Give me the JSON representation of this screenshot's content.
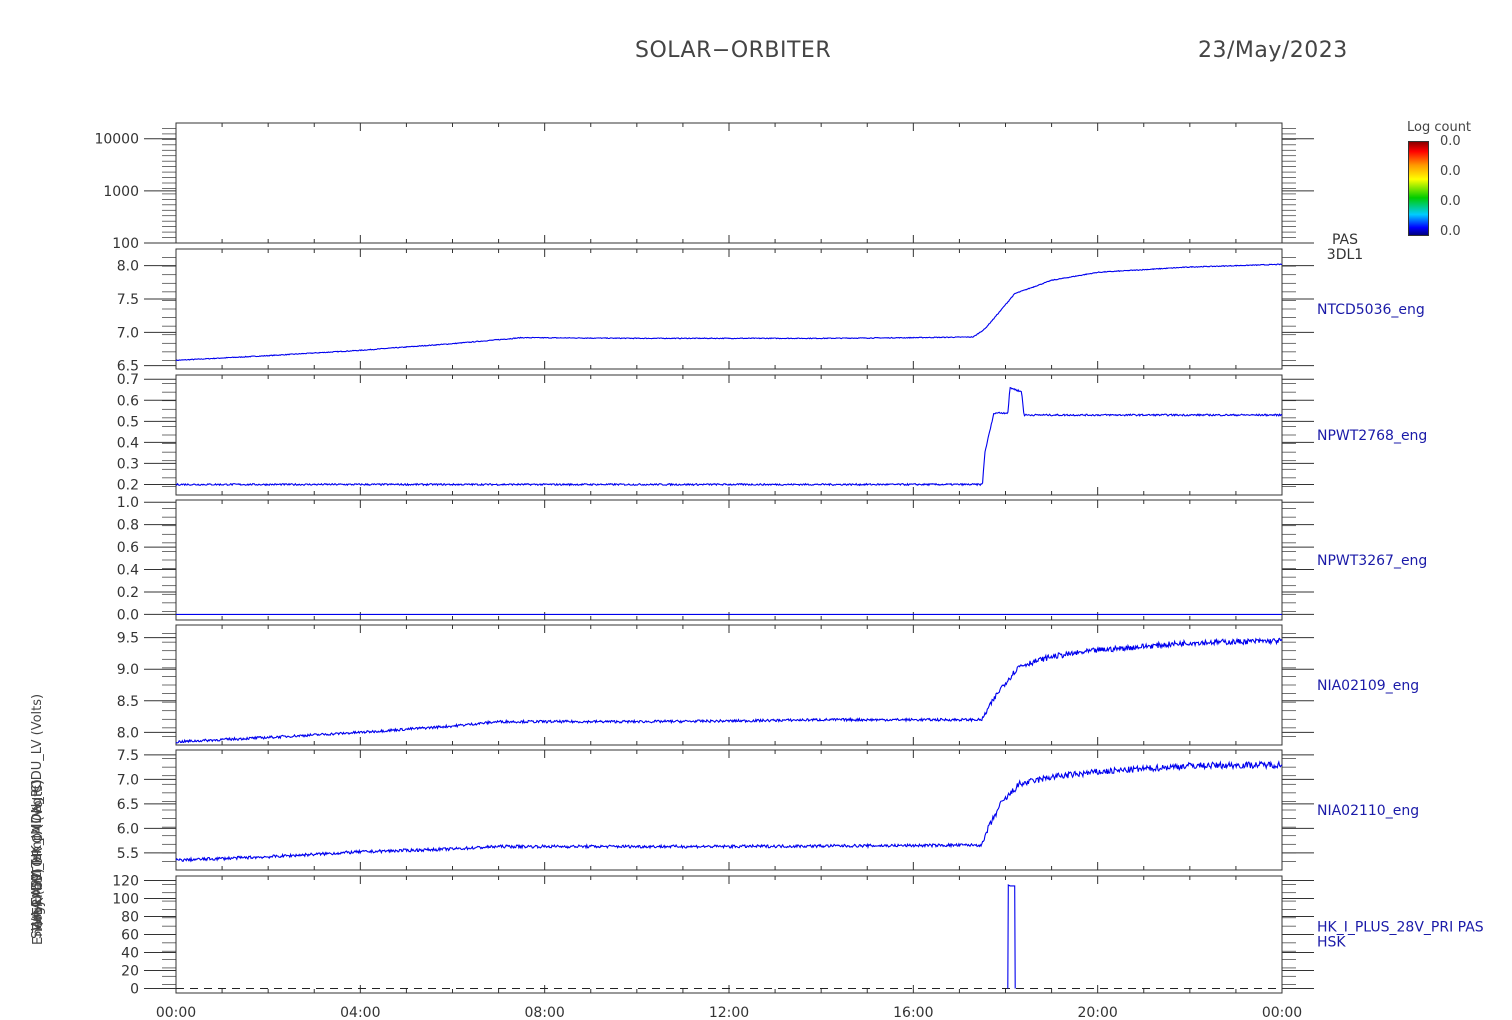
{
  "header": {
    "title": "SOLAR−ORBITER",
    "date": "23/May/2023"
  },
  "colorbar": {
    "title": "Log count",
    "labels": [
      "0.0",
      "0.0",
      "0.0",
      "0.0"
    ]
  },
  "y_labels_overlapping": [
    "Energy (eV)",
    "SWA-EAS1 Temp (Deg C)",
    "THERMISTOR CA (Volts)",
    "(mA) DM_HK_IMON_PCDU_LV (Volts)"
  ],
  "colors": {
    "trace": "#0000ee",
    "axis": "#333333",
    "label": "#1a1aa8"
  },
  "chart_data": {
    "type": "line",
    "x_ticks": [
      "00:00",
      "04:00",
      "08:00",
      "12:00",
      "16:00",
      "20:00",
      "00:00"
    ],
    "x_range_hours": [
      0,
      24
    ],
    "panels": [
      {
        "label_lines": [
          "PAS",
          "3DL1"
        ],
        "type": "heatmap",
        "yscale": "log",
        "ylim": [
          100,
          20000
        ],
        "yticks": [
          "10000",
          "1000",
          "100"
        ],
        "ytick_values": [
          10000,
          1000,
          100
        ],
        "series": []
      },
      {
        "label_lines": [
          "NTCD5036_eng"
        ],
        "ylim": [
          6.45,
          8.25
        ],
        "yticks": [
          "8.0",
          "7.5",
          "7.0",
          "6.5"
        ],
        "ytick_values": [
          8.0,
          7.5,
          7.0,
          6.5
        ],
        "series": [
          {
            "x": [
              0,
              2,
              4,
              6,
              7.5,
              10,
              12,
              14,
              16,
              17.3,
              17.55,
              17.8,
              18.2,
              19,
              20,
              22,
              24
            ],
            "y": [
              6.58,
              6.65,
              6.73,
              6.83,
              6.92,
              6.91,
              6.91,
              6.91,
              6.92,
              6.93,
              7.05,
              7.25,
              7.58,
              7.78,
              7.9,
              7.98,
              8.02
            ]
          }
        ]
      },
      {
        "label_lines": [
          "NPWT2768_eng"
        ],
        "ylim": [
          0.15,
          0.72
        ],
        "yticks": [
          "0.7",
          "0.6",
          "0.5",
          "0.4",
          "0.3",
          "0.2"
        ],
        "ytick_values": [
          0.7,
          0.6,
          0.5,
          0.4,
          0.3,
          0.2
        ],
        "series": [
          {
            "x": [
              0,
              17.5,
              17.55,
              17.75,
              18.05,
              18.1,
              18.35,
              18.4,
              24
            ],
            "y": [
              0.2,
              0.2,
              0.35,
              0.54,
              0.54,
              0.66,
              0.64,
              0.53,
              0.53
            ]
          }
        ]
      },
      {
        "label_lines": [
          "NPWT3267_eng"
        ],
        "ylim": [
          -0.05,
          1.02
        ],
        "yticks": [
          "1.0",
          "0.8",
          "0.6",
          "0.4",
          "0.2",
          "0.0"
        ],
        "ytick_values": [
          1.0,
          0.8,
          0.6,
          0.4,
          0.2,
          0.0
        ],
        "series": [
          {
            "x": [
              0,
              24
            ],
            "y": [
              0.0,
              0.0
            ]
          }
        ]
      },
      {
        "label_lines": [
          "NIA02109_eng"
        ],
        "ylim": [
          7.8,
          9.7
        ],
        "yticks": [
          "9.5",
          "9.0",
          "8.5",
          "8.0"
        ],
        "ytick_values": [
          9.5,
          9.0,
          8.5,
          8.0
        ],
        "series": [
          {
            "x": [
              0,
              2,
              4,
              6,
              7,
              10,
              12,
              14,
              16,
              17.5,
              17.6,
              17.9,
              18.3,
              19,
              20,
              22,
              24
            ],
            "y": [
              7.85,
              7.92,
              8.0,
              8.1,
              8.17,
              8.17,
              8.18,
              8.2,
              8.2,
              8.2,
              8.35,
              8.7,
              9.05,
              9.2,
              9.3,
              9.42,
              9.45
            ]
          }
        ]
      },
      {
        "label_lines": [
          "NIA02110_eng"
        ],
        "ylim": [
          5.15,
          7.6
        ],
        "yticks": [
          "7.5",
          "7.0",
          "6.5",
          "6.0",
          "5.5"
        ],
        "ytick_values": [
          7.5,
          7.0,
          6.5,
          6.0,
          5.5
        ],
        "series": [
          {
            "x": [
              0,
              2,
              4,
              6,
              7,
              10,
              12,
              14,
              16,
              17.5,
              17.6,
              17.9,
              18.3,
              19,
              20,
              22,
              24
            ],
            "y": [
              5.35,
              5.42,
              5.52,
              5.58,
              5.63,
              5.63,
              5.63,
              5.64,
              5.65,
              5.66,
              5.95,
              6.5,
              6.9,
              7.05,
              7.15,
              7.28,
              7.3
            ]
          }
        ]
      },
      {
        "label_lines": [
          "HK_I_PLUS_28V_PRI PAS",
          "HSK"
        ],
        "ylim": [
          -5,
          125
        ],
        "yticks": [
          "120",
          "100",
          "80",
          "60",
          "40",
          "20",
          "0"
        ],
        "ytick_values": [
          120,
          100,
          80,
          60,
          40,
          20,
          0
        ],
        "zero_line": "dashed",
        "series": [
          {
            "x": [
              18.05,
              18.06,
              18.1,
              18.2,
              18.21
            ],
            "y": [
              0,
              115,
              114,
              114,
              0
            ]
          }
        ]
      }
    ]
  }
}
